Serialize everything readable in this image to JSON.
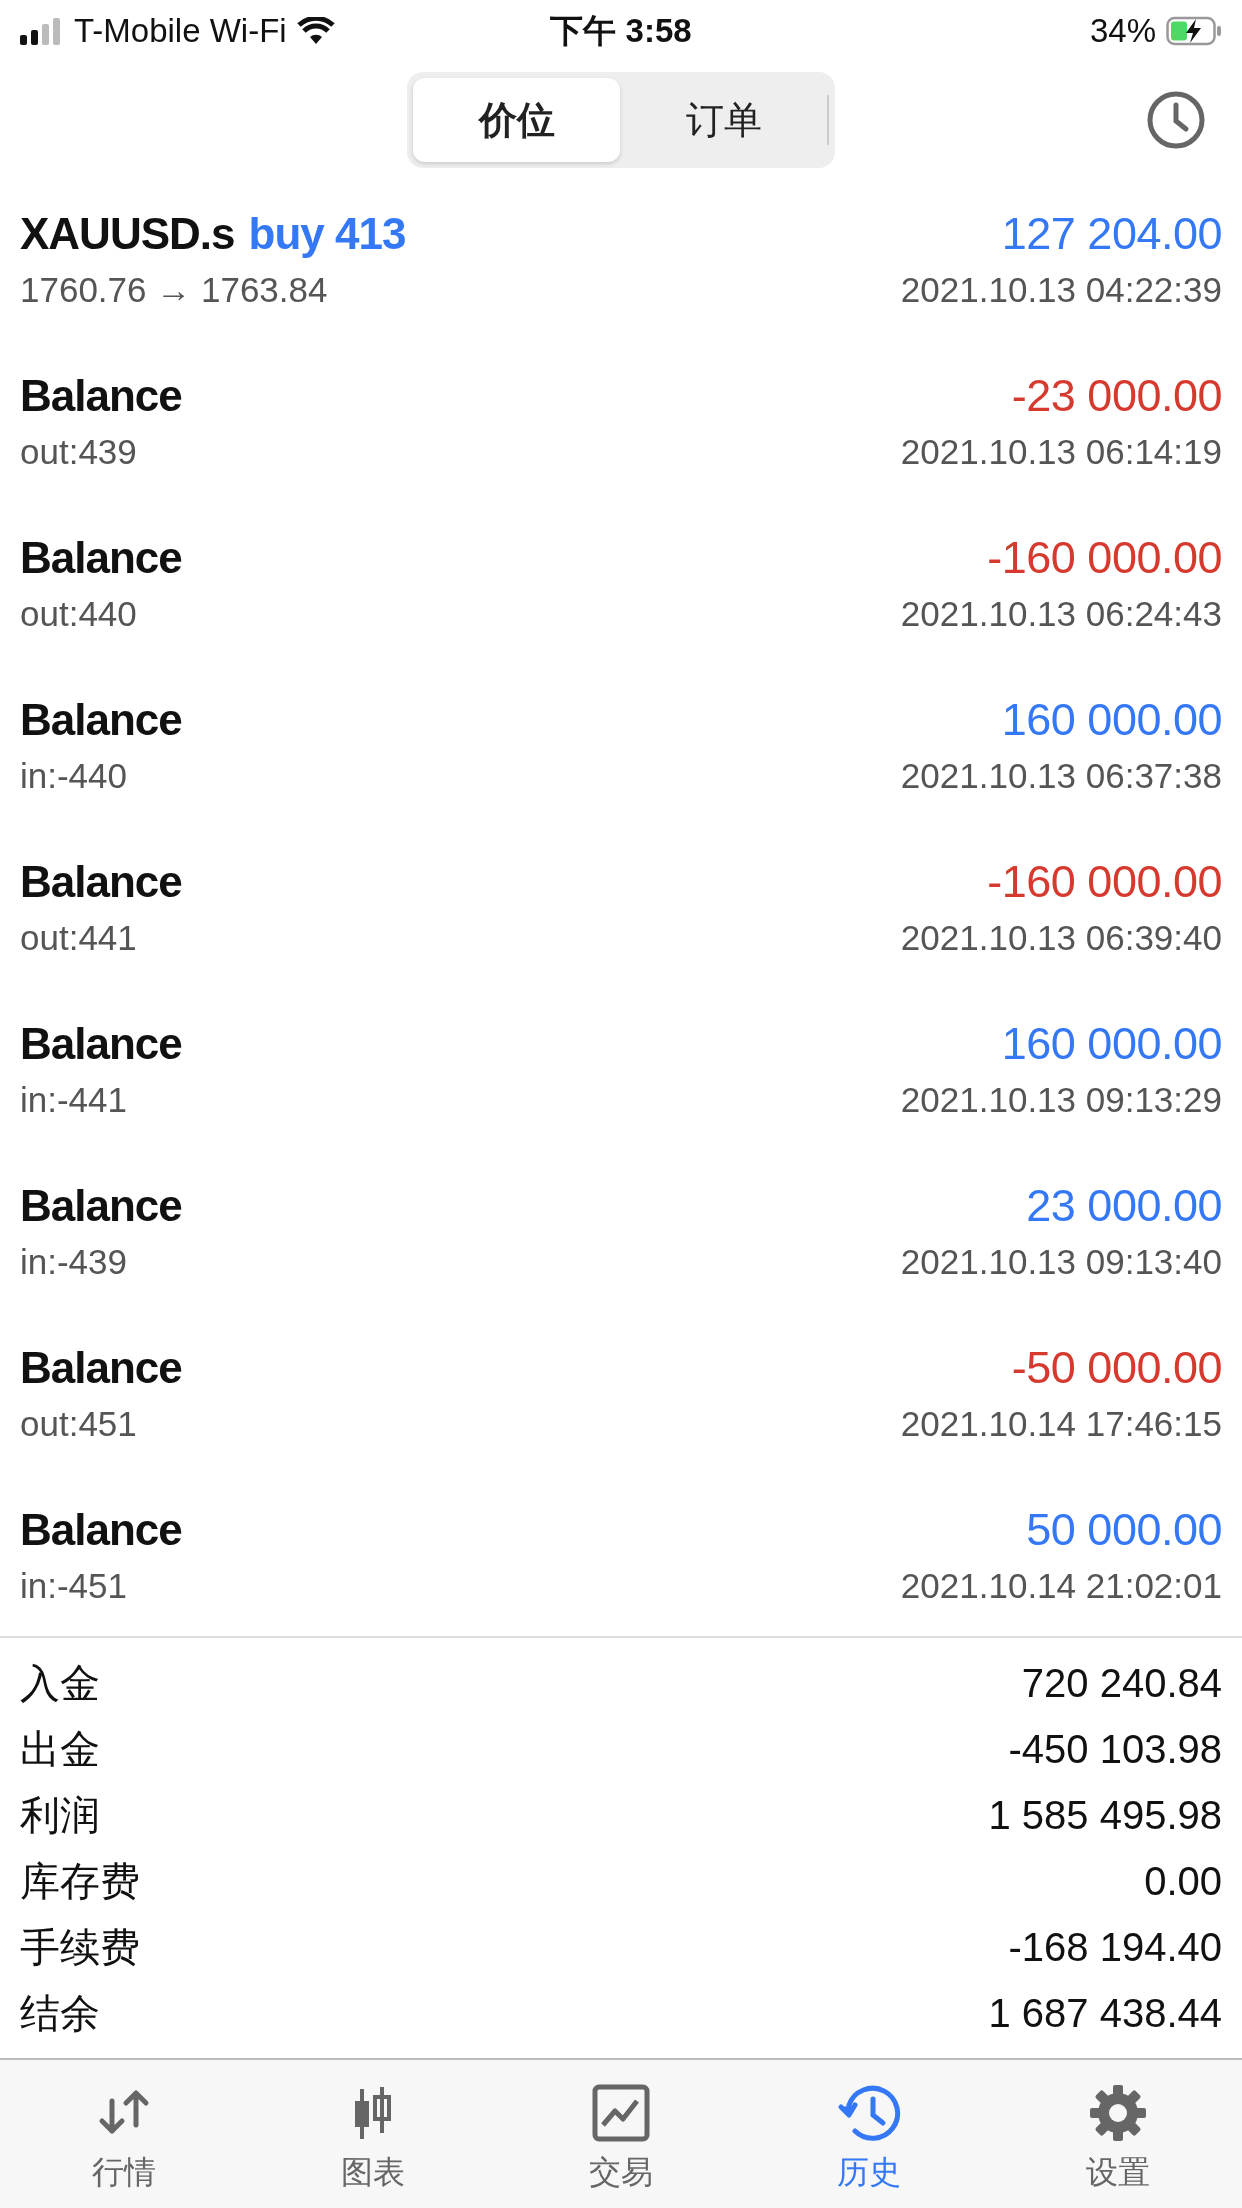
{
  "status_bar": {
    "carrier": "T-Mobile Wi-Fi",
    "time": "下午 3:58",
    "battery": "34%"
  },
  "segments": [
    {
      "label": "价位",
      "selected": true
    },
    {
      "label": "订单",
      "selected": false
    }
  ],
  "deals": [
    {
      "kind": "trade",
      "title": "XAUUSD.s",
      "action": "buy 413",
      "detail": "1760.76 → 1763.84",
      "amount": "127 204.00",
      "color": "#3478f6",
      "time": "2021.10.13 04:22:39"
    },
    {
      "kind": "balance",
      "title": "Balance",
      "detail": "out:439",
      "amount": "-23 000.00",
      "color": "#d63a2f",
      "time": "2021.10.13 06:14:19"
    },
    {
      "kind": "balance",
      "title": "Balance",
      "detail": "out:440",
      "amount": "-160 000.00",
      "color": "#d63a2f",
      "time": "2021.10.13 06:24:43"
    },
    {
      "kind": "balance",
      "title": "Balance",
      "detail": "in:-440",
      "amount": "160 000.00",
      "color": "#3478f6",
      "time": "2021.10.13 06:37:38"
    },
    {
      "kind": "balance",
      "title": "Balance",
      "detail": "out:441",
      "amount": "-160 000.00",
      "color": "#d63a2f",
      "time": "2021.10.13 06:39:40"
    },
    {
      "kind": "balance",
      "title": "Balance",
      "detail": "in:-441",
      "amount": "160 000.00",
      "color": "#3478f6",
      "time": "2021.10.13 09:13:29"
    },
    {
      "kind": "balance",
      "title": "Balance",
      "detail": "in:-439",
      "amount": "23 000.00",
      "color": "#3478f6",
      "time": "2021.10.13 09:13:40"
    },
    {
      "kind": "balance",
      "title": "Balance",
      "detail": "out:451",
      "amount": "-50 000.00",
      "color": "#d63a2f",
      "time": "2021.10.14 17:46:15"
    },
    {
      "kind": "balance",
      "title": "Balance",
      "detail": "in:-451",
      "amount": "50 000.00",
      "color": "#3478f6",
      "time": "2021.10.14 21:02:01"
    }
  ],
  "summary": [
    {
      "label": "入金",
      "value": "720 240.84"
    },
    {
      "label": "出金",
      "value": "-450 103.98"
    },
    {
      "label": "利润",
      "value": "1 585 495.98"
    },
    {
      "label": "库存费",
      "value": "0.00"
    },
    {
      "label": "手续费",
      "value": "-168 194.40"
    },
    {
      "label": "结余",
      "value": "1 687 438.44"
    }
  ],
  "tab_bar": [
    {
      "label": "行情",
      "kind": "quotes",
      "selected": false
    },
    {
      "label": "图表",
      "kind": "chart",
      "selected": false
    },
    {
      "label": "交易",
      "kind": "trade",
      "selected": false
    },
    {
      "label": "历史",
      "kind": "history",
      "selected": true
    },
    {
      "label": "设置",
      "kind": "settings",
      "selected": false
    }
  ]
}
